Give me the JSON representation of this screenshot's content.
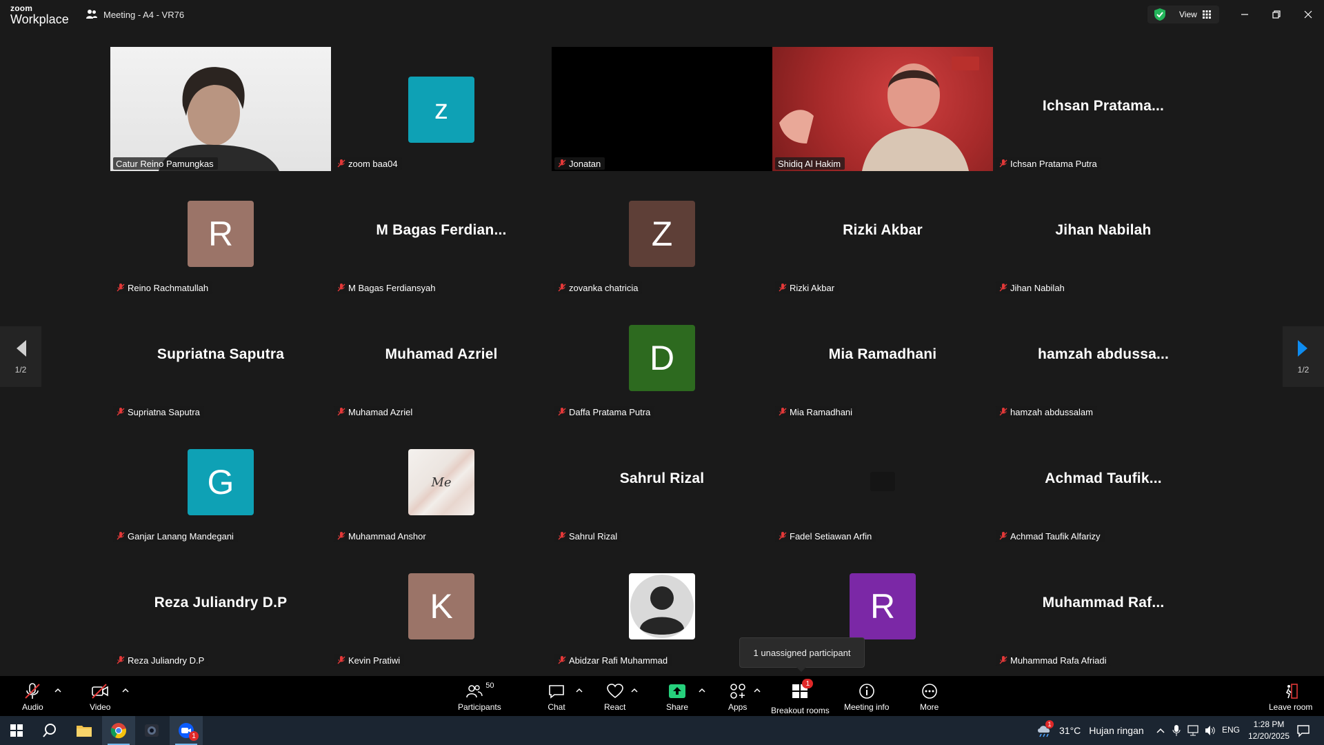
{
  "app": {
    "logo_small": "zoom",
    "logo_big": "Workplace",
    "meeting_title": "Meeting - A4 - VR76",
    "view_label": "View"
  },
  "colors": {
    "active_border": "#2bcf8a",
    "mic_muted": "#e23838",
    "share_green": "#26d07c",
    "badge_red": "#e02828"
  },
  "tiles": [
    {
      "name": "Catur Reino Pamungkas",
      "type": "video"
    },
    {
      "name": "zoom baa04",
      "type": "avatar",
      "letter": "z",
      "color": "#0ea1b5"
    },
    {
      "name": "Jonatan",
      "type": "video-off"
    },
    {
      "name": "Shidiq Al Hakim",
      "type": "video",
      "active": true
    },
    {
      "name": "Ichsan Pratama Putra",
      "type": "name",
      "display": "Ichsan  Pratama..."
    },
    {
      "name": "Reino Rachmatullah",
      "type": "avatar",
      "letter": "R",
      "color": "#9b7468"
    },
    {
      "name": "M Bagas Ferdiansyah",
      "type": "name",
      "display": "M  Bagas  Ferdian..."
    },
    {
      "name": "zovanka chatricia",
      "type": "avatar",
      "letter": "Z",
      "color": "#5e3f37"
    },
    {
      "name": "Rizki Akbar",
      "type": "name",
      "display": "Rizki Akbar"
    },
    {
      "name": "Jihan Nabilah",
      "type": "name",
      "display": "Jihan Nabilah"
    },
    {
      "name": "Supriatna Saputra",
      "type": "name",
      "display": "Supriatna Saputra"
    },
    {
      "name": "Muhamad Azriel",
      "type": "name",
      "display": "Muhamad Azriel"
    },
    {
      "name": "Daffa Pratama Putra",
      "type": "avatar",
      "letter": "D",
      "color": "#2d6a1f"
    },
    {
      "name": "Mia Ramadhani",
      "type": "name",
      "display": "Mia Ramadhani"
    },
    {
      "name": "hamzah abdussalam",
      "type": "name",
      "display": "hamzah  abdussa..."
    },
    {
      "name": "Ganjar Lanang Mandegani",
      "type": "avatar",
      "letter": "G",
      "color": "#0ea1b5"
    },
    {
      "name": "Muhammad Anshor",
      "type": "marble",
      "letter": "Me"
    },
    {
      "name": "Sahrul Rizal",
      "type": "name",
      "display": "Sahrul Rizal"
    },
    {
      "name": "Fadel Setiawan Arfin",
      "type": "blank-photo"
    },
    {
      "name": "Achmad Taufik Alfarizy",
      "type": "name",
      "display": "Achmad  Taufik..."
    },
    {
      "name": "Reza Juliandry D.P",
      "type": "name",
      "display": "Reza Juliandry D.P"
    },
    {
      "name": "Kevin Pratiwi",
      "type": "avatar",
      "letter": "K",
      "color": "#9b7468"
    },
    {
      "name": "Abidzar Rafi Muhammad",
      "type": "default-avatar"
    },
    {
      "name": "",
      "type": "avatar",
      "letter": "R",
      "color": "#7b28a6"
    },
    {
      "name": "Muhammad Rafa Afriadi",
      "type": "name",
      "display": "Muhammad  Raf..."
    }
  ],
  "nav": {
    "left_page": "1/2",
    "right_page": "1/2"
  },
  "tooltip": "1 unassigned participant",
  "toolbar": {
    "audio": "Audio",
    "video": "Video",
    "participants": "Participants",
    "participants_count": "50",
    "chat": "Chat",
    "react": "React",
    "share": "Share",
    "apps": "Apps",
    "breakout": "Breakout rooms",
    "breakout_badge": "1",
    "meeting_info": "Meeting info",
    "more": "More",
    "leave": "Leave room"
  },
  "taskbar": {
    "weather_temp": "31°C",
    "weather_text": "Hujan ringan",
    "weather_badge": "1",
    "lang": "ENG",
    "time": "1:28 PM",
    "date": "12/20/2025",
    "zoom_badge": "1"
  }
}
